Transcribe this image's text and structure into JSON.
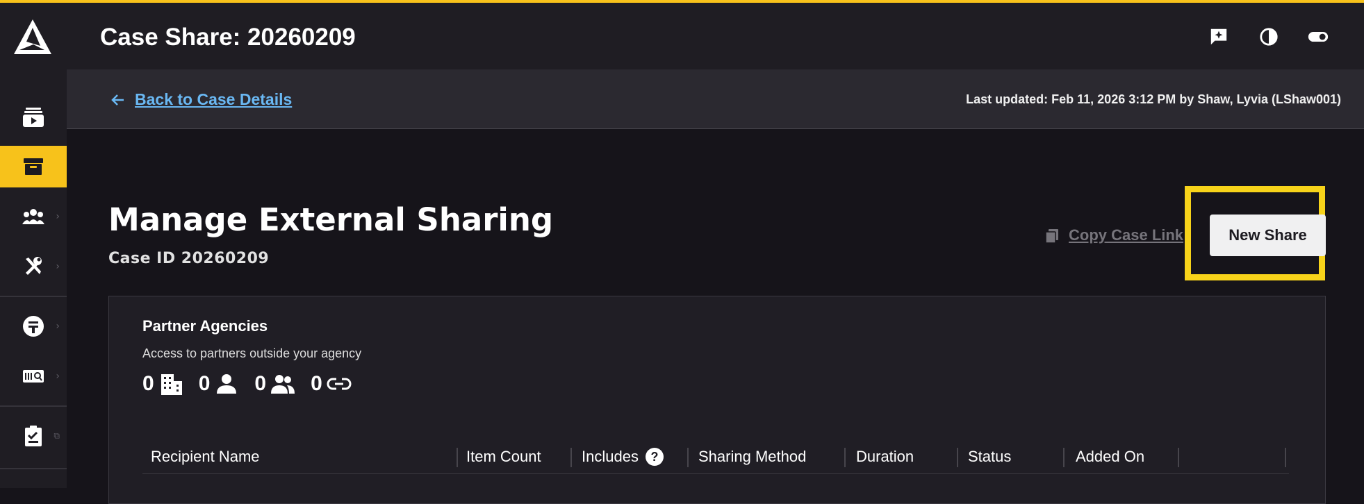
{
  "header": {
    "title": "Case Share: 20260209",
    "icons": [
      "feedback-icon",
      "contrast-icon",
      "toggle-icon"
    ]
  },
  "subbar": {
    "back_label": "Back to Case Details",
    "last_updated": "Last updated: Feb 11, 2026 3:12 PM by Shaw, Lyvia (LShaw001)"
  },
  "main": {
    "heading": "Manage External Sharing",
    "case_id": "Case ID 20260209",
    "copy_link_label": "Copy Case Link",
    "new_share_label": "New Share"
  },
  "card": {
    "title": "Partner Agencies",
    "subtitle": "Access to partners outside your agency",
    "stats": {
      "agencies": "0",
      "users": "0",
      "groups": "0",
      "links": "0"
    },
    "columns": [
      "Recipient Name",
      "Item Count",
      "Includes",
      "Sharing Method",
      "Duration",
      "Status",
      "Added On"
    ]
  },
  "sidebar": {
    "items": [
      "media-icon",
      "case-box-icon",
      "people-icon",
      "tools-icon",
      "evidence-icon",
      "barcode-icon",
      "clipboard-icon"
    ]
  },
  "colors": {
    "accent": "#f7c21b",
    "link": "#6ab8f3",
    "highlight": "#f7d31a"
  }
}
